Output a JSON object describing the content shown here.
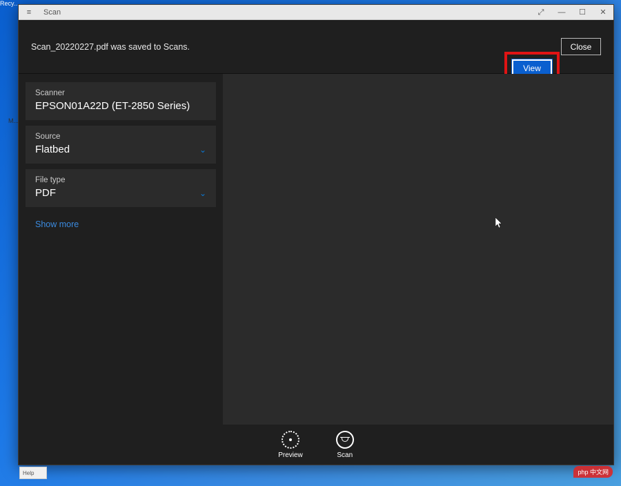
{
  "desktop": {
    "recycle_label": "Recy..."
  },
  "window": {
    "title": "Scan",
    "hamburger": "≡",
    "expand": "⤢",
    "minimize": "—",
    "maximize": "☐",
    "close": "✕"
  },
  "notification": {
    "message": "Scan_20220227.pdf was saved to Scans.",
    "view_label": "View",
    "close_label": "Close"
  },
  "sidebar": {
    "scanner": {
      "label": "Scanner",
      "value": "EPSON01A22D (ET-2850 Series)"
    },
    "source": {
      "label": "Source",
      "value": "Flatbed"
    },
    "filetype": {
      "label": "File type",
      "value": "PDF"
    },
    "show_more": "Show more"
  },
  "bottom": {
    "preview": "Preview",
    "scan": "Scan"
  },
  "misc": {
    "badge": "php 中文网",
    "behind_m": "M...",
    "behind_help": "Help"
  }
}
